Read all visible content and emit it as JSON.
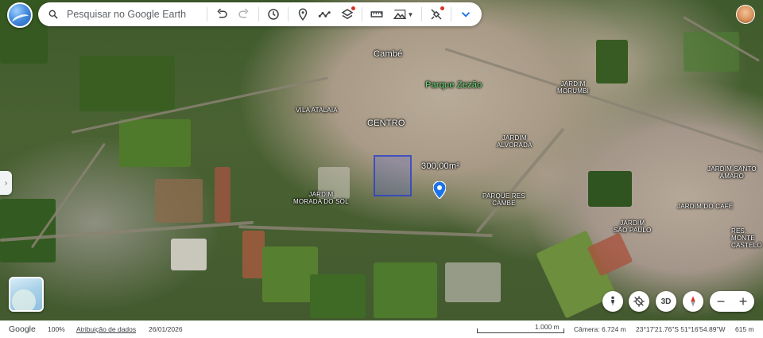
{
  "search": {
    "placeholder": "Pesquisar no Google Earth"
  },
  "toolbar": {
    "icons": [
      "search-icon",
      "undo-icon",
      "redo-icon",
      "history-icon",
      "place-marker-icon",
      "path-icon",
      "layers-icon",
      "ruler-icon",
      "image-overlay-icon",
      "satellite-icon",
      "collapse-chevron-icon"
    ]
  },
  "map": {
    "labels": {
      "cambe": "Cambé",
      "parque_zezao": "Parque Zezão",
      "centro": "CENTRO",
      "vila_atalaia": "VILA ATALAIA",
      "jardim_morumbi": "JARDIM\nMORUMBI",
      "jardim_alvorada": "JARDIM\nALVORADA",
      "jardim_morada_do_sol": "JARDIM\nMORADA DO SOL",
      "parque_res_cambe": "PARQUE RES\nCAMBE",
      "jardim_santo_amaro": "JARDIM SANTO\nAMARO",
      "jardim_do_cafe": "JARDIM DO CAFÉ",
      "jardim_sao_paulo": "JARDIM\nSÃO PAULO",
      "res_monte_castelo": "RES. MONTE\nCASTELO"
    },
    "area_label": "300,00m²",
    "marker_color": "#1a73e8"
  },
  "controls": {
    "pegman": "pegman-icon",
    "location_off": "location-off-icon",
    "view_3d": "3D",
    "compass": "compass-icon",
    "zoom_out": "−",
    "zoom_in": "+"
  },
  "status": {
    "google": "Google",
    "zoom": "100%",
    "attribution": "Atribuição de dados",
    "date": "26/01/2026",
    "scale": "1.000 m",
    "camera": "Câmera: 6.724 m",
    "coords": "23°17'21.76\"S 51°16'54.89\"W",
    "elevation": "615 m"
  }
}
